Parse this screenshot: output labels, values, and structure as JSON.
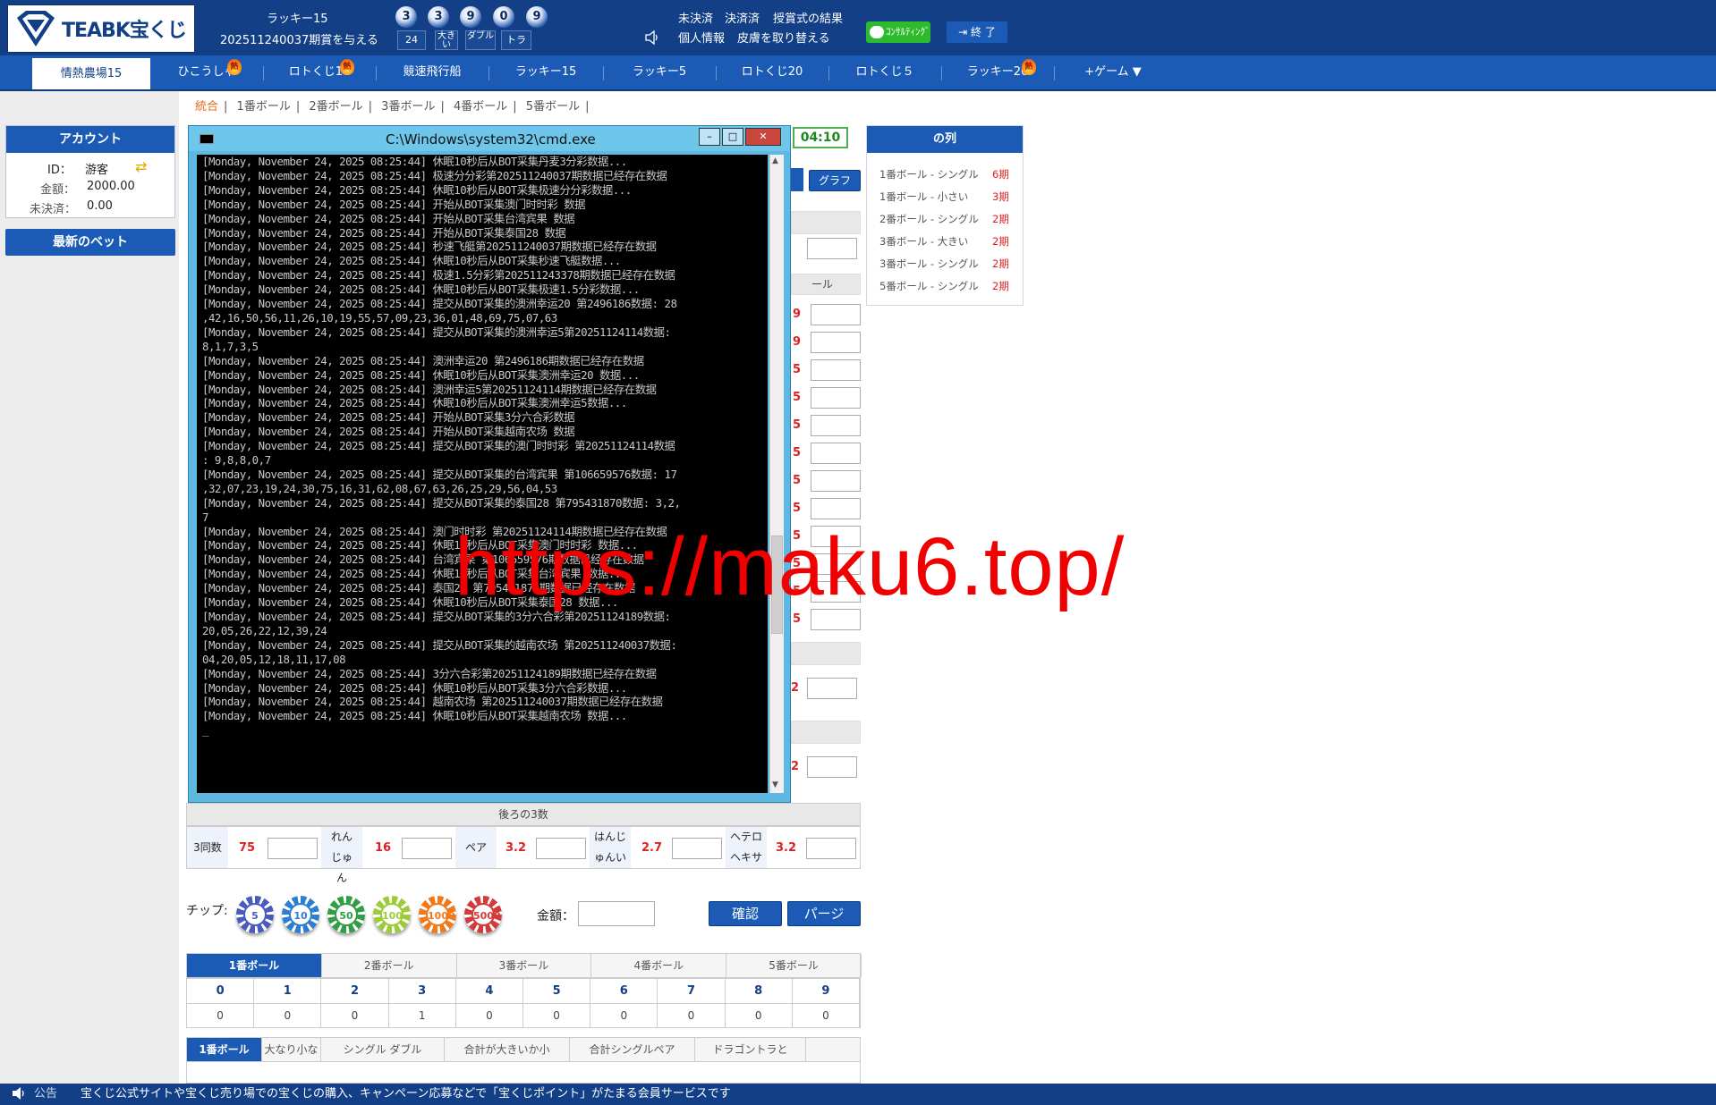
{
  "brand": {
    "name": "TEABK宝くじ"
  },
  "header": {
    "lottery_name": "ラッキー15",
    "period_text": "202511240037期賞を与える",
    "balls": [
      "3",
      "3",
      "9",
      "0",
      "9"
    ],
    "sum": "24",
    "tag_big": "大きい",
    "tag_double": "ダブル",
    "tag_tiger": "トラ",
    "links": {
      "unsettled": "未決済",
      "settled": "決済済",
      "award_results": "授賞式の結果",
      "profile": "個人情報",
      "skin": "皮膚を取り替える"
    },
    "consult_label": "ｺﾝｻﾙﾃｨﾝｸﾞ",
    "logout_label": "終 了"
  },
  "nav": {
    "items": [
      {
        "label": "情熱農場15",
        "hot": false
      },
      {
        "label": "ひこうしゃ",
        "hot": true
      },
      {
        "label": "ロトくじ10",
        "hot": true
      },
      {
        "label": "競速飛行船",
        "hot": false
      },
      {
        "label": "ラッキー15",
        "hot": false
      },
      {
        "label": "ラッキー5",
        "hot": false
      },
      {
        "label": "ロトくじ20",
        "hot": false
      },
      {
        "label": "ロトくじ５",
        "hot": false
      },
      {
        "label": "ラッキー20",
        "hot": true
      },
      {
        "label": "+ゲーム ▼",
        "hot": false
      }
    ],
    "hot_badge": "熱"
  },
  "subnav": {
    "items": [
      "統合",
      "1番ボール",
      "2番ボール",
      "3番ボール",
      "4番ボール",
      "5番ボール"
    ]
  },
  "account": {
    "title": "アカウント",
    "id_label": "ID：",
    "id_value": "游客",
    "balance_label": "金額：",
    "balance_value": "2000.00",
    "unsettled_label": "未決済：",
    "unsettled_value": "0.00",
    "latest_bets": "最新のベット"
  },
  "timer": "04:10",
  "graph_button": "グラフ",
  "ball_col_label": "ール",
  "partial_odds": [
    "9",
    "9",
    "5",
    "5",
    "5",
    "5",
    "5",
    "5",
    "5",
    "5",
    "5",
    "5"
  ],
  "partial_odds2": [
    "2",
    "2"
  ],
  "right_list": {
    "title": "の列",
    "items": [
      {
        "label": "1番ボール - シングル",
        "count": "6期"
      },
      {
        "label": "1番ボール - 小さい",
        "count": "3期"
      },
      {
        "label": "2番ボール - シングル",
        "count": "2期"
      },
      {
        "label": "3番ボール - 大きい",
        "count": "2期"
      },
      {
        "label": "3番ボール - シングル",
        "count": "2期"
      },
      {
        "label": "5番ボール - シングル",
        "count": "2期"
      }
    ]
  },
  "cmd": {
    "title": "C:\\Windows\\system32\\cmd.exe",
    "lines": [
      "[Monday, November 24, 2025 08:25:44] 休眠10秒后从BOT采集丹麦3分彩数据...",
      "[Monday, November 24, 2025 08:25:44] 极速分分彩第202511240037期数据已经存在数据",
      "[Monday, November 24, 2025 08:25:44] 休眠10秒后从BOT采集极速分分彩数据...",
      "[Monday, November 24, 2025 08:25:44] 开始从BOT采集澳门时时彩 数据",
      "[Monday, November 24, 2025 08:25:44] 开始从BOT采集台湾宾果 数据",
      "[Monday, November 24, 2025 08:25:44] 开始从BOT采集泰国28 数据",
      "[Monday, November 24, 2025 08:25:44] 秒速飞艇第202511240037期数据已经存在数据",
      "[Monday, November 24, 2025 08:25:44] 休眠10秒后从BOT采集秒速飞艇数据...",
      "[Monday, November 24, 2025 08:25:44] 极速1.5分彩第202511243378期数据已经存在数据",
      "[Monday, November 24, 2025 08:25:44] 休眠10秒后从BOT采集极速1.5分彩数据...",
      "[Monday, November 24, 2025 08:25:44] 提交从BOT采集的澳洲幸运20 第2496186数据: 28",
      ",42,16,50,56,11,26,10,19,55,57,09,23,36,01,48,69,75,07,63",
      "[Monday, November 24, 2025 08:25:44] 提交从BOT采集的澳洲幸运5第20251124114数据:",
      "8,1,7,3,5",
      "[Monday, November 24, 2025 08:25:44] 澳洲幸运20 第2496186期数据已经存在数据",
      "[Monday, November 24, 2025 08:25:44] 休眠10秒后从BOT采集澳洲幸运20 数据...",
      "[Monday, November 24, 2025 08:25:44] 澳洲幸运5第20251124114期数据已经存在数据",
      "[Monday, November 24, 2025 08:25:44] 休眠10秒后从BOT采集澳洲幸运5数据...",
      "[Monday, November 24, 2025 08:25:44] 开始从BOT采集3分六合彩数据",
      "[Monday, November 24, 2025 08:25:44] 开始从BOT采集越南农场 数据",
      "[Monday, November 24, 2025 08:25:44] 提交从BOT采集的澳门时时彩 第20251124114数据",
      ": 9,8,8,0,7",
      "[Monday, November 24, 2025 08:25:44] 提交从BOT采集的台湾宾果 第106659576数据: 17",
      ",32,07,23,19,24,30,75,16,31,62,08,67,63,26,25,29,56,04,53",
      "[Monday, November 24, 2025 08:25:44] 提交从BOT采集的泰国28 第795431870数据: 3,2,",
      "7",
      "[Monday, November 24, 2025 08:25:44] 澳门时时彩 第20251124114期数据已经存在数据",
      "[Monday, November 24, 2025 08:25:44] 休眠10秒后从BOT采集澳门时时彩 数据...",
      "[Monday, November 24, 2025 08:25:44] 台湾宾果 第106659576期数据已经存在数据",
      "[Monday, November 24, 2025 08:25:44] 休眠10秒后从BOT采集台湾宾果 数据...",
      "[Monday, November 24, 2025 08:25:44] 泰国28 第795431870期数据已经存在数据",
      "[Monday, November 24, 2025 08:25:44] 休眠10秒后从BOT采集泰国28 数据...",
      "[Monday, November 24, 2025 08:25:44] 提交从BOT采集的3分六合彩第20251124189数据:",
      "20,05,26,22,12,39,24",
      "[Monday, November 24, 2025 08:25:44] 提交从BOT采集的越南农场 第202511240037数据:",
      "04,20,05,12,18,11,17,08",
      "[Monday, November 24, 2025 08:25:44] 3分六合彩第20251124189期数据已经存在数据",
      "[Monday, November 24, 2025 08:25:44] 休眠10秒后从BOT采集3分六合彩数据...",
      "[Monday, November 24, 2025 08:25:44] 越南农场 第202511240037期数据已经存在数据",
      "[Monday, November 24, 2025 08:25:44] 休眠10秒后从BOT采集越南农场 数据...",
      "",
      "_"
    ]
  },
  "back3": {
    "title": "後ろの3数",
    "cells": [
      {
        "label": "3同数",
        "odds": "75"
      },
      {
        "label": "れんじゅん",
        "odds": "16"
      },
      {
        "label": "ペア",
        "odds": "3.2"
      },
      {
        "label": "はんじゅんい",
        "odds": "2.7"
      },
      {
        "label": "ヘテロヘキサ",
        "odds": "3.2"
      }
    ]
  },
  "chips": {
    "label": "チップ:",
    "values": [
      "5",
      "10",
      "50",
      "100",
      "1000",
      "5000"
    ],
    "colors": [
      "#4a5bc0",
      "#2e7ed0",
      "#2f9e44",
      "#9ccc3a",
      "#f07a1a",
      "#d43a3a"
    ]
  },
  "amount_label": "金額：",
  "confirm_label": "確認",
  "page_label": "パージ",
  "stats": {
    "tabs": [
      "1番ボール",
      "2番ボール",
      "3番ボール",
      "4番ボール",
      "5番ボール"
    ],
    "digits": [
      "0",
      "1",
      "2",
      "3",
      "4",
      "5",
      "6",
      "7",
      "8",
      "9"
    ],
    "counts": [
      "0",
      "0",
      "0",
      "1",
      "0",
      "0",
      "0",
      "0",
      "0",
      "0"
    ]
  },
  "bottom_tabs": [
    "1番ボール",
    "大なり小な",
    "シングル ダブル",
    "合計が大きいか小",
    "合計シングルペア",
    "ドラゴントラと"
  ],
  "watermark": "https://maku6.top/",
  "footer": {
    "label": "公告",
    "text": "宝くじ公式サイトや宝くじ売り場での宝くじの購入、キャンペーン応募などで「宝くじポイント」がたまる会員サービスです"
  }
}
